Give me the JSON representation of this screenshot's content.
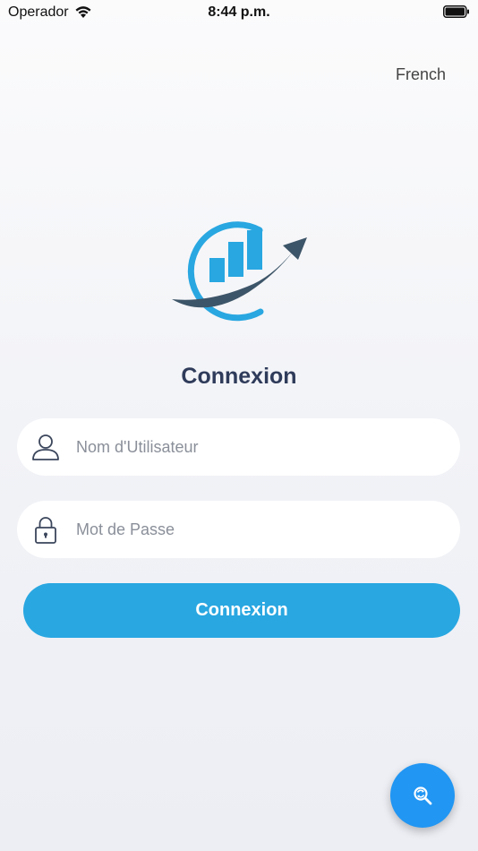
{
  "status_bar": {
    "carrier": "Operador",
    "time": "8:44 p.m."
  },
  "header": {
    "language": "French"
  },
  "logo": {
    "icon": "chart-growth-logo",
    "colors": {
      "light_blue": "#29a7e1",
      "dark_slate": "#3d5568"
    }
  },
  "login": {
    "title": "Connexion",
    "username": {
      "value": "",
      "placeholder": "Nom d'Utilisateur",
      "icon": "user-icon"
    },
    "password": {
      "value": "",
      "placeholder": "Mot de Passe",
      "icon": "lock-icon"
    },
    "submit_label": "Connexion"
  },
  "fab": {
    "icon": "search-refresh-icon"
  },
  "colors": {
    "accent": "#29a7e1",
    "fab": "#2196f3",
    "title": "#2f3b5a",
    "background": "#f2f3f7"
  }
}
